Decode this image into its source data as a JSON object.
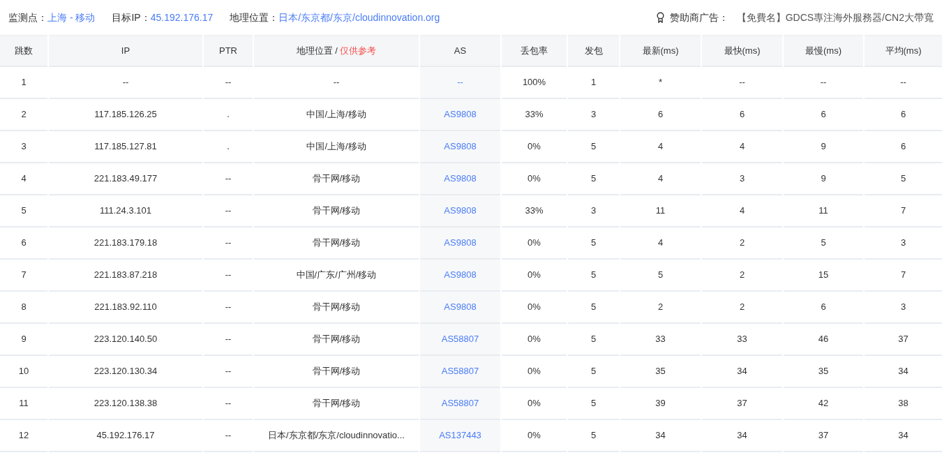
{
  "info_bar": {
    "items": [
      {
        "label": "监测点：",
        "value": "上海 - 移动"
      },
      {
        "label": "目标IP：",
        "value": "45.192.176.17"
      },
      {
        "label": "地理位置：",
        "value": "日本/东京都/东京/cloudinnovation.org"
      }
    ],
    "sponsor": {
      "label": "赞助商广告：",
      "text": "【免費名】GDCS專注海外服務器/CN2大帶寬"
    }
  },
  "table": {
    "columns": [
      {
        "label": "跳数"
      },
      {
        "label": "IP"
      },
      {
        "label": "PTR"
      },
      {
        "label": "地理位置 / ",
        "note": "仅供参考"
      },
      {
        "label": "AS"
      },
      {
        "label": "丢包率"
      },
      {
        "label": "发包"
      },
      {
        "label": "最新(ms)"
      },
      {
        "label": "最快(ms)"
      },
      {
        "label": "最慢(ms)"
      },
      {
        "label": "平均(ms)"
      }
    ],
    "rows": [
      [
        "1",
        "--",
        "--",
        "--",
        "--",
        "100%",
        "1",
        "*",
        "--",
        "--",
        "--"
      ],
      [
        "2",
        "117.185.126.25",
        ".",
        "中国/上海/移动",
        "AS9808",
        "33%",
        "3",
        "6",
        "6",
        "6",
        "6"
      ],
      [
        "3",
        "117.185.127.81",
        ".",
        "中国/上海/移动",
        "AS9808",
        "0%",
        "5",
        "4",
        "4",
        "9",
        "6"
      ],
      [
        "4",
        "221.183.49.177",
        "--",
        "骨干网/移动",
        "AS9808",
        "0%",
        "5",
        "4",
        "3",
        "9",
        "5"
      ],
      [
        "5",
        "111.24.3.101",
        "--",
        "骨干网/移动",
        "AS9808",
        "33%",
        "3",
        "11",
        "4",
        "11",
        "7"
      ],
      [
        "6",
        "221.183.179.18",
        "--",
        "骨干网/移动",
        "AS9808",
        "0%",
        "5",
        "4",
        "2",
        "5",
        "3"
      ],
      [
        "7",
        "221.183.87.218",
        "--",
        "中国/广东/广州/移动",
        "AS9808",
        "0%",
        "5",
        "5",
        "2",
        "15",
        "7"
      ],
      [
        "8",
        "221.183.92.110",
        "--",
        "骨干网/移动",
        "AS9808",
        "0%",
        "5",
        "2",
        "2",
        "6",
        "3"
      ],
      [
        "9",
        "223.120.140.50",
        "--",
        "骨干网/移动",
        "AS58807",
        "0%",
        "5",
        "33",
        "33",
        "46",
        "37"
      ],
      [
        "10",
        "223.120.130.34",
        "--",
        "骨干网/移动",
        "AS58807",
        "0%",
        "5",
        "35",
        "34",
        "35",
        "34"
      ],
      [
        "11",
        "223.120.138.38",
        "--",
        "骨干网/移动",
        "AS58807",
        "0%",
        "5",
        "39",
        "37",
        "42",
        "38"
      ],
      [
        "12",
        "45.192.176.17",
        "--",
        "日本/东京都/东京/cloudinnovatio...",
        "AS137443",
        "0%",
        "5",
        "34",
        "34",
        "37",
        "34"
      ]
    ]
  }
}
